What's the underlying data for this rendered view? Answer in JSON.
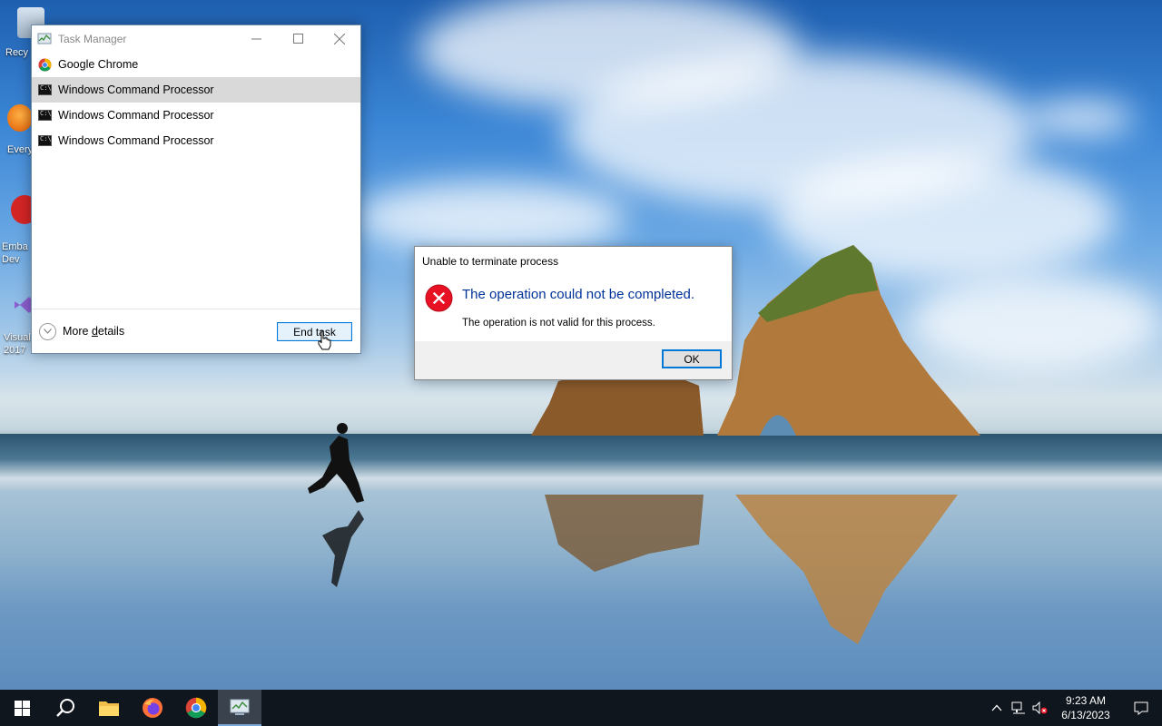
{
  "desktop": {
    "icons": [
      {
        "label": "Recy"
      },
      {
        "label": "Every"
      },
      {
        "label": "Emba\nDev"
      },
      {
        "label": "Visual\n2017"
      }
    ]
  },
  "task_manager": {
    "title": "Task Manager",
    "processes": [
      {
        "name": "Google Chrome",
        "icon": "chrome-icon",
        "selected": false
      },
      {
        "name": "Windows Command Processor",
        "icon": "cmd-icon",
        "selected": true
      },
      {
        "name": "Windows Command Processor",
        "icon": "cmd-icon",
        "selected": false
      },
      {
        "name": "Windows Command Processor",
        "icon": "cmd-icon",
        "selected": false
      }
    ],
    "more_details_label": "More details",
    "more_details_accesskey": "d",
    "end_task_label": "End task"
  },
  "dialog": {
    "title": "Unable to terminate process",
    "main_instruction": "The operation could not be completed.",
    "content": "The operation is not valid for this process.",
    "ok_label": "OK",
    "icon": "error-icon"
  },
  "taskbar": {
    "pinned": [
      "windows-start-icon",
      "search-icon",
      "file-explorer-icon",
      "firefox-icon",
      "chrome-icon",
      "task-manager-icon"
    ],
    "active_app": "task-manager-icon",
    "clock_time": "9:23 AM",
    "clock_date": "6/13/2023"
  }
}
